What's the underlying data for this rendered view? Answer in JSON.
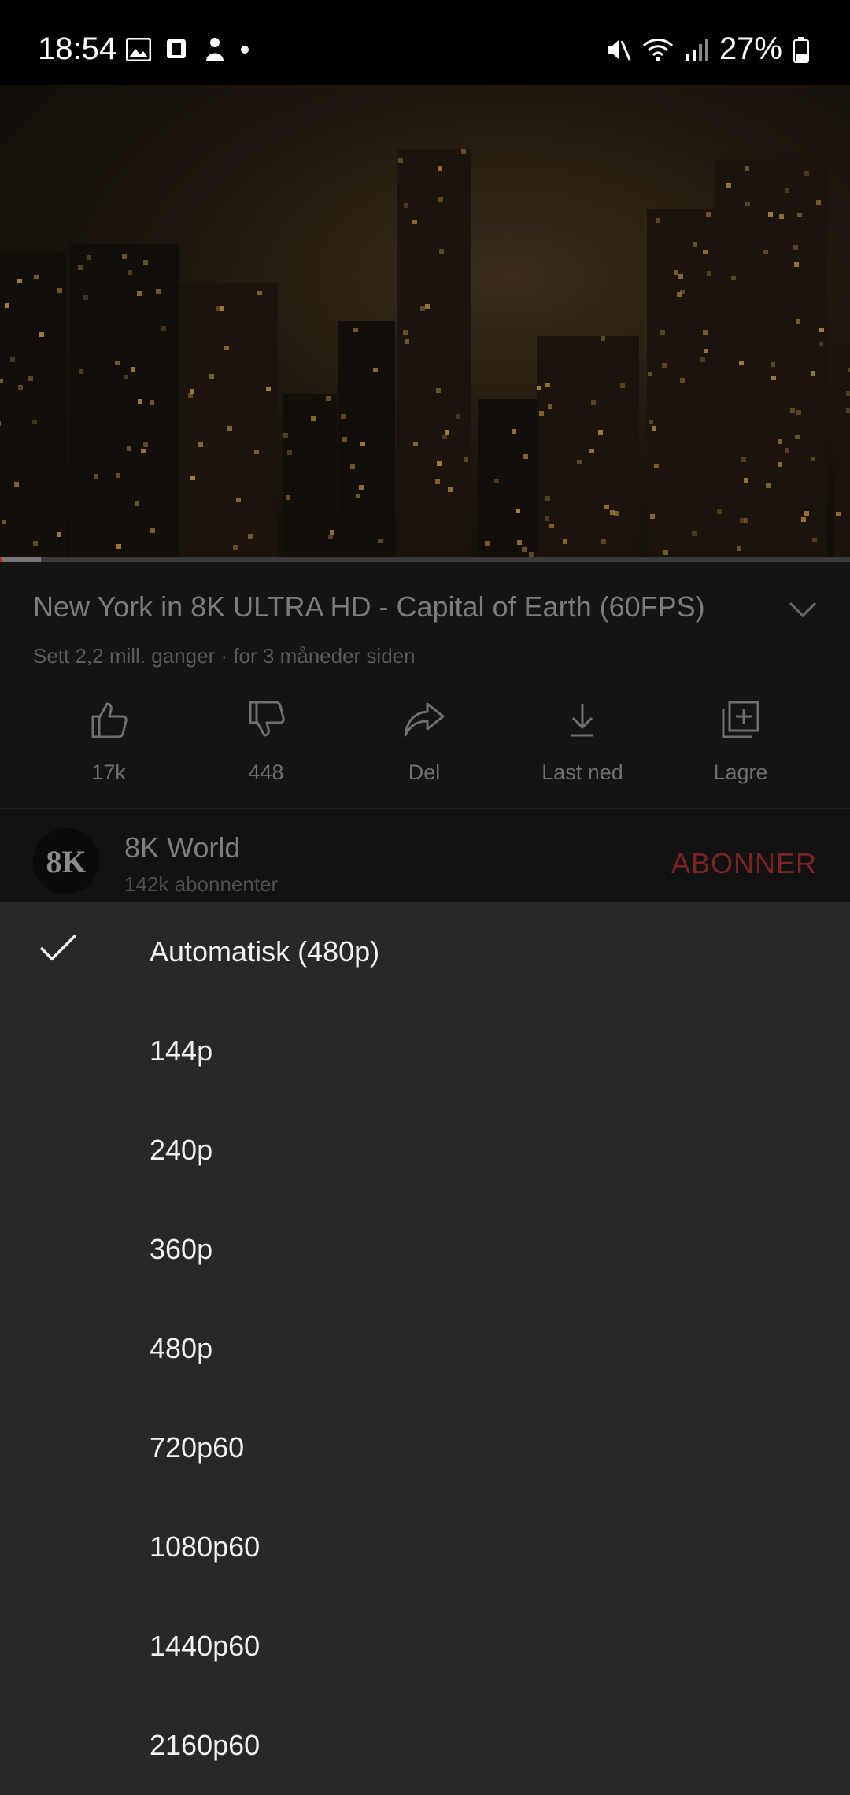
{
  "status_bar": {
    "time": "18:54",
    "left_icons": [
      "image-icon",
      "notification-icon",
      "app-icon",
      "dot-icon"
    ],
    "right_icons": [
      "mute-icon",
      "wifi-icon",
      "signal-icon",
      "battery-icon"
    ],
    "battery": "27%"
  },
  "video": {
    "progress_percent": 5,
    "colors": {
      "progress": "#cc2222"
    }
  },
  "video_info": {
    "title": "New York in 8K ULTRA HD - Capital of Earth (60FPS)",
    "meta": "Sett 2,2 mill. ganger · for 3 måneder siden",
    "actions": [
      {
        "icon": "thumbs-up-icon",
        "label": "17k"
      },
      {
        "icon": "thumbs-down-icon",
        "label": "448"
      },
      {
        "icon": "share-icon",
        "label": "Del"
      },
      {
        "icon": "download-icon",
        "label": "Last ned"
      },
      {
        "icon": "save-playlist-icon",
        "label": "Lagre"
      }
    ]
  },
  "channel": {
    "avatar_text": "8K",
    "name": "8K World",
    "subscribers": "142k abonnenter",
    "subscribe_label": "ABONNER"
  },
  "quality_menu": {
    "options": [
      {
        "label": "Automatisk (480p)",
        "selected": true
      },
      {
        "label": "144p",
        "selected": false
      },
      {
        "label": "240p",
        "selected": false
      },
      {
        "label": "360p",
        "selected": false
      },
      {
        "label": "480p",
        "selected": false
      },
      {
        "label": "720p60",
        "selected": false
      },
      {
        "label": "1080p60",
        "selected": false
      },
      {
        "label": "1440p60",
        "selected": false
      },
      {
        "label": "2160p60",
        "selected": false
      }
    ]
  }
}
